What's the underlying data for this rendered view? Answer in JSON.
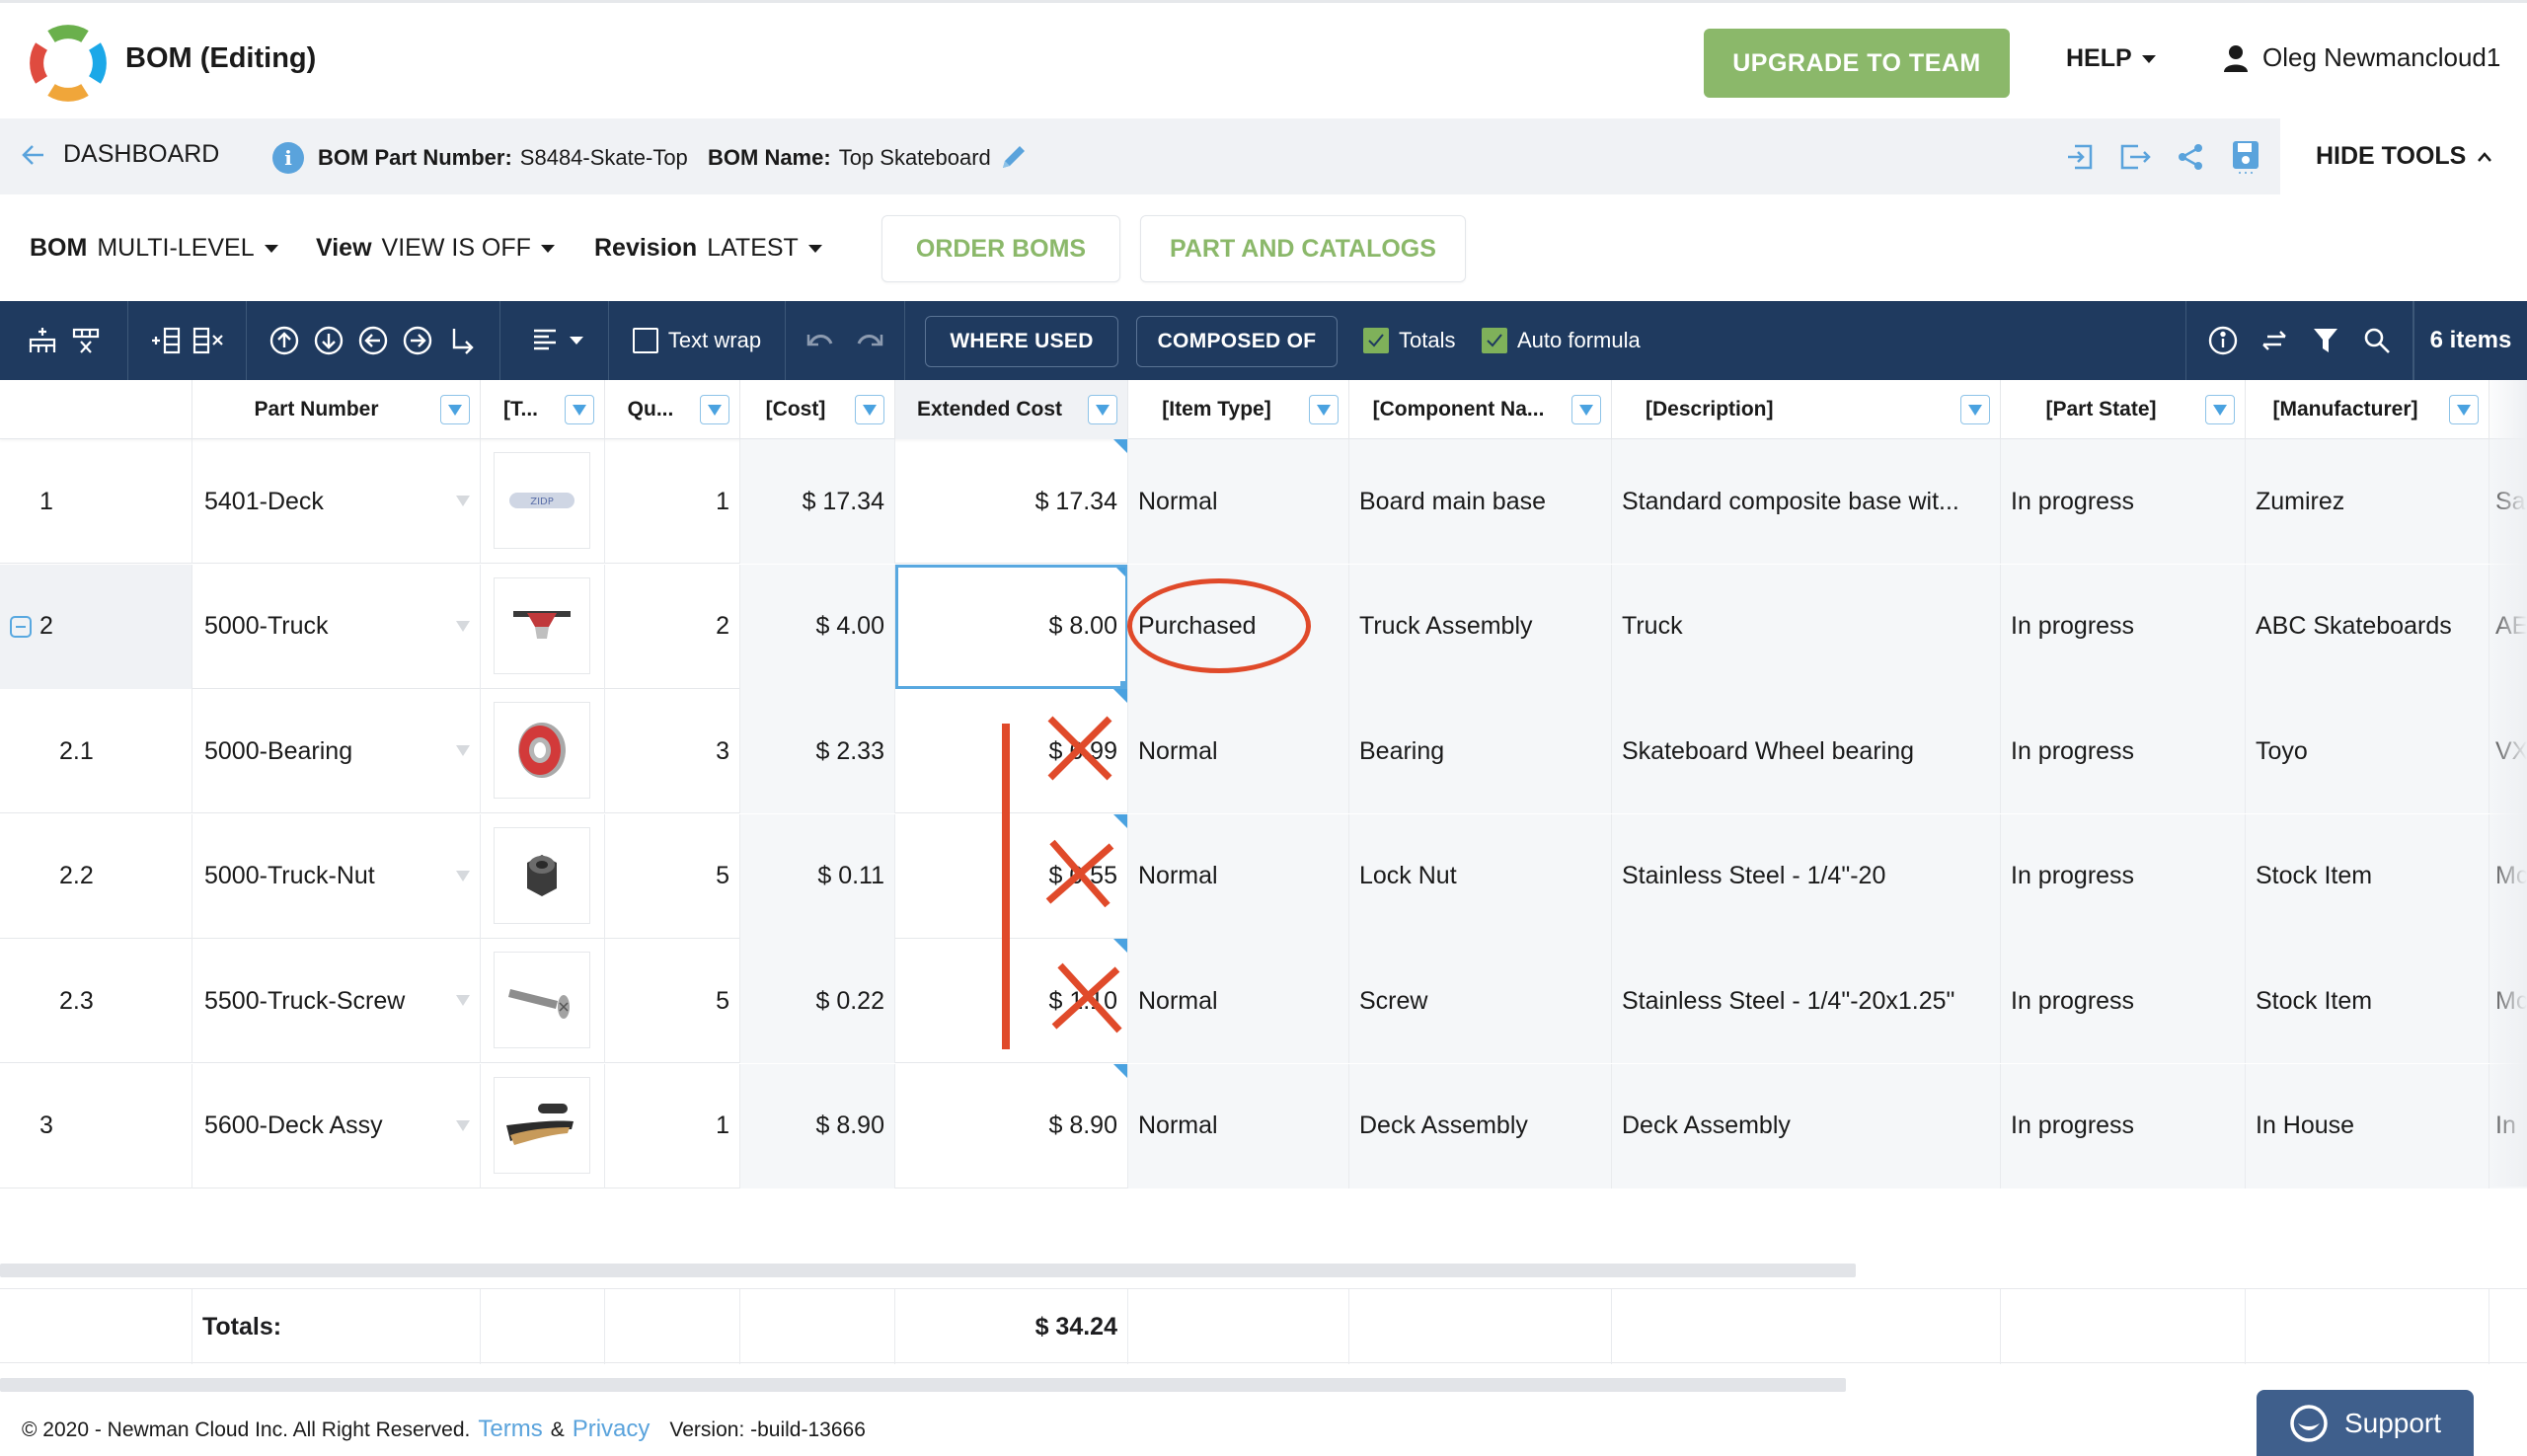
{
  "header": {
    "title": "BOM (Editing)",
    "upgrade_label": "UPGRADE TO TEAM",
    "help_label": "HELP",
    "user_name": "Oleg Newmancloud1",
    "logo_colors": [
      "#6ab04c",
      "#1ba8e8",
      "#f0a63a",
      "#df4b3f"
    ]
  },
  "subheader": {
    "back_label": "DASHBOARD",
    "part_number_label": "BOM Part Number:",
    "part_number_value": "S8484-Skate-Top",
    "bom_name_label": "BOM Name:",
    "bom_name_value": "Top Skateboard",
    "hide_tools_label": "HIDE TOOLS"
  },
  "controls": {
    "bom_label": "BOM",
    "bom_value": "MULTI-LEVEL",
    "view_label": "View",
    "view_value": "VIEW IS OFF",
    "revision_label": "Revision",
    "revision_value": "LATEST",
    "order_boms_label": "ORDER BOMS",
    "part_catalogs_label": "PART AND CATALOGS"
  },
  "toolbar": {
    "text_wrap_label": "Text wrap",
    "text_wrap_checked": false,
    "where_used_label": "WHERE USED",
    "composed_of_label": "COMPOSED OF",
    "totals_label": "Totals",
    "totals_checked": true,
    "auto_formula_label": "Auto formula",
    "auto_formula_checked": true,
    "items_count": "6 items"
  },
  "grid": {
    "columns": [
      "",
      "Part Number",
      "[T...",
      "Qu...",
      "[Cost]",
      "Extended Cost",
      "[Item Type]",
      "[Component Na...",
      "[Description]",
      "[Part State]",
      "[Manufacturer]",
      ""
    ],
    "rows": [
      {
        "index": "1",
        "part_number": "5401-Deck",
        "thumb": "deck-image",
        "qty": "1",
        "cost": "$ 17.34",
        "ext_cost": "$ 17.34",
        "item_type": "Normal",
        "component": "Board main base",
        "description": "Standard composite base wit...",
        "part_state": "In progress",
        "manufacturer": "Zumirez",
        "next": "Sa"
      },
      {
        "index": "2",
        "part_number": "5000-Truck",
        "thumb": "truck-image",
        "qty": "2",
        "cost": "$ 4.00",
        "ext_cost": "$ 8.00",
        "item_type": "Purchased",
        "component": "Truck Assembly",
        "description": "Truck",
        "part_state": "In progress",
        "manufacturer": "ABC Skateboards",
        "next": "AE"
      },
      {
        "index": "2.1",
        "part_number": "5000-Bearing",
        "thumb": "bearing-image",
        "qty": "3",
        "cost": "$ 2.33",
        "ext_cost": "$ 6.99",
        "item_type": "Normal",
        "component": "Bearing",
        "description": "Skateboard Wheel bearing",
        "part_state": "In progress",
        "manufacturer": "Toyo",
        "next": "VX"
      },
      {
        "index": "2.2",
        "part_number": "5000-Truck-Nut",
        "thumb": "nut-image",
        "qty": "5",
        "cost": "$ 0.11",
        "ext_cost": "$ 0.55",
        "item_type": "Normal",
        "component": "Lock Nut",
        "description": "Stainless Steel - 1/4\"-20",
        "part_state": "In progress",
        "manufacturer": "Stock Item",
        "next": "Mc"
      },
      {
        "index": "2.3",
        "part_number": "5500-Truck-Screw",
        "thumb": "screw-image",
        "qty": "5",
        "cost": "$ 0.22",
        "ext_cost": "$ 1.10",
        "item_type": "Normal",
        "component": "Screw",
        "description": "Stainless Steel - 1/4\"-20x1.25\"",
        "part_state": "In progress",
        "manufacturer": "Stock Item",
        "next": "Mc"
      },
      {
        "index": "3",
        "part_number": "5600-Deck Assy",
        "thumb": "deck-assy-image",
        "qty": "1",
        "cost": "$ 8.90",
        "ext_cost": "$ 8.90",
        "item_type": "Normal",
        "component": "Deck Assembly",
        "description": "Deck Assembly",
        "part_state": "In progress",
        "manufacturer": "In House",
        "next": "In"
      }
    ],
    "totals_label": "Totals:",
    "totals_ext_cost": "$ 34.24"
  },
  "footer": {
    "copyright": "© 2020 - Newman Cloud Inc. All Right Reserved.",
    "terms_label": "Terms",
    "amp": "&",
    "privacy_label": "Privacy",
    "version": "Version: -build-13666",
    "support_label": "Support"
  },
  "colors": {
    "accent_green": "#8bb86a",
    "toolbar_navy": "#1f3a5f",
    "link_blue": "#5aa3dc",
    "annotation_red": "#e04a2a"
  }
}
